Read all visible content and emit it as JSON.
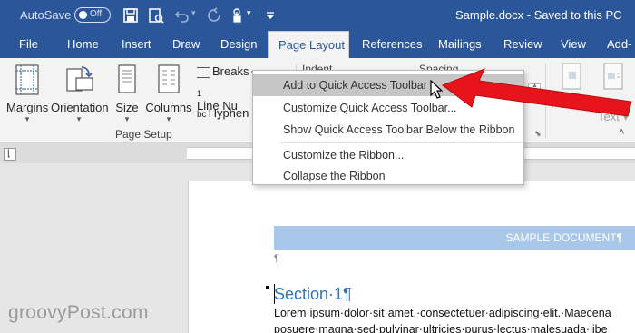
{
  "title_bar": {
    "autosave_label": "AutoSave",
    "autosave_state": "Off",
    "document_title": "Sample.docx  -  Saved to this PC"
  },
  "tabs": [
    {
      "label": "File",
      "active": false
    },
    {
      "label": "Home",
      "active": false
    },
    {
      "label": "Insert",
      "active": false
    },
    {
      "label": "Draw",
      "active": false
    },
    {
      "label": "Design",
      "active": false
    },
    {
      "label": "Page Layout",
      "active": true
    },
    {
      "label": "References",
      "active": false
    },
    {
      "label": "Mailings",
      "active": false
    },
    {
      "label": "Review",
      "active": false
    },
    {
      "label": "View",
      "active": false
    },
    {
      "label": "Add-",
      "active": false
    }
  ],
  "ribbon": {
    "margins": "Margins",
    "orientation": "Orientation",
    "size": "Size",
    "columns": "Columns",
    "breaks": "Breaks",
    "line_numbers": "Line Nu",
    "hyphenation": "Hyphen",
    "group_label": "Page Setup",
    "indent": "Indent",
    "spacing": "Spacing",
    "position": "Position",
    "wrap_text_1": "Wrap",
    "wrap_text_2": "Text"
  },
  "context_menu": {
    "items": [
      "Add to Quick Access Toolbar",
      "Customize Quick Access Toolbar...",
      "Show Quick Access Toolbar Below the Ribbon",
      "Customize the Ribbon...",
      "Collapse the Ribbon"
    ],
    "hovered_index": 0
  },
  "document": {
    "banner": "SAMPLE·DOCUMENT¶",
    "pilcrow": "¶",
    "section_heading": "Section·1¶",
    "lines": [
      "Lorem·ipsum·dolor·sit·amet,·consectetuer·adipiscing·elit.·Maecena",
      "posuere·magna·sed·pulvinar·ultricies·purus·lectus·malesuada·libe"
    ]
  },
  "watermark": "groovyPost.com",
  "colors": {
    "title_bar": "#2b579a",
    "ribbon": "#f3f3f3",
    "menu_hover": "#c6c6c6",
    "annotation_arrow": "#e8141b",
    "banner": "#a9c7e8",
    "heading": "#2e74b5"
  }
}
